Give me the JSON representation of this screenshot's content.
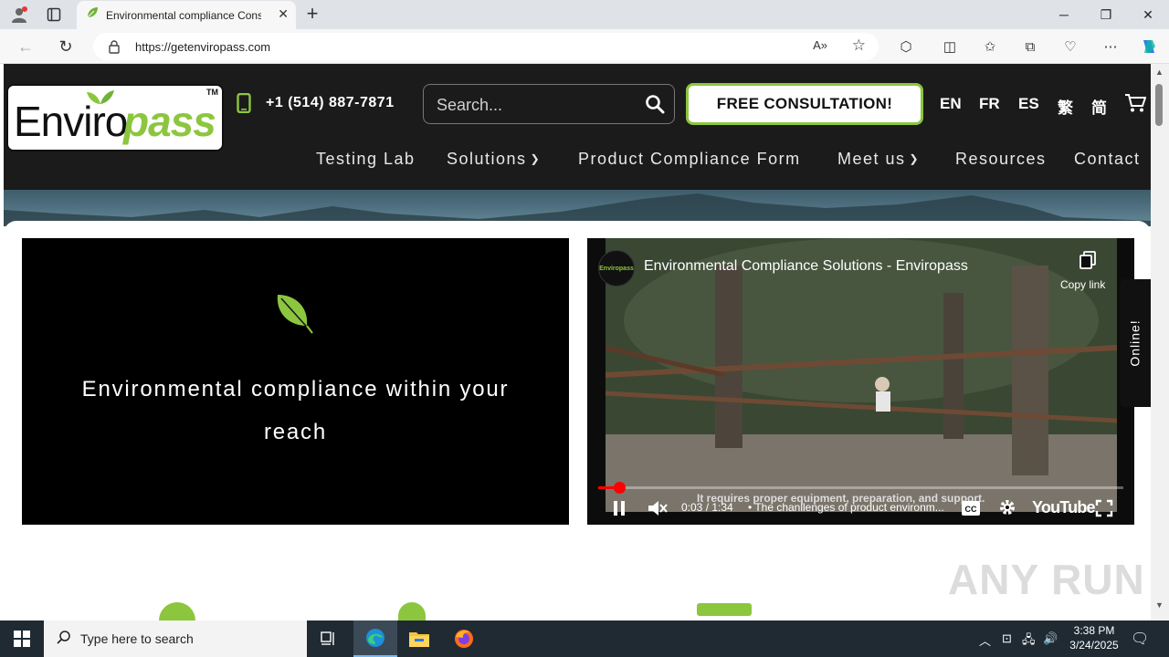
{
  "browser": {
    "tab_title": "Environmental compliance Cons",
    "url": "https://getenviropass.com"
  },
  "site": {
    "logo_part1": "Enviro",
    "logo_part2": "pass",
    "logo_tm": "TM",
    "phone": "+1 (514) 887-7871",
    "search_placeholder": "Search...",
    "cta_label": "FREE CONSULTATION!",
    "languages": [
      "EN",
      "FR",
      "ES",
      "繁",
      "简"
    ],
    "menu": [
      {
        "label": "Testing Lab",
        "has_dropdown": false
      },
      {
        "label": "Solutions",
        "has_dropdown": true
      },
      {
        "label": "Product Compliance Form",
        "has_dropdown": false
      },
      {
        "label": "Meet us",
        "has_dropdown": true
      },
      {
        "label": "Resources",
        "has_dropdown": false
      },
      {
        "label": "Contact",
        "has_dropdown": false
      }
    ],
    "accent_color": "#8cc63f",
    "promo_text": "Environmental compliance within your reach",
    "online_label": "Online!",
    "watermark": "ANY RUN"
  },
  "video": {
    "title": "Environmental Compliance Solutions - Enviropass",
    "channel_avatar_text": "Enviropass",
    "copy_link_label": "Copy link",
    "caption": "It requires proper equipment, preparation, and support.",
    "time": "0:03 / 1:34",
    "subtitle": "• The chanllenges of product environm...",
    "yt_label": "YouTube",
    "progress_fraction": 0.04
  },
  "taskbar": {
    "search_placeholder": "Type here to search",
    "time": "3:38 PM",
    "date": "3/24/2025"
  }
}
